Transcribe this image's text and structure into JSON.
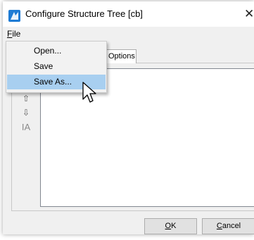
{
  "window": {
    "title": "Configure Structure Tree [cb]",
    "close_glyph": "✕",
    "icon": "app-logo-icon"
  },
  "menubar": {
    "file_label_underlined": "F",
    "file_label_rest": "ile"
  },
  "file_menu": {
    "items": [
      {
        "label": "Open..."
      },
      {
        "label": "Save"
      },
      {
        "label": "Save As...",
        "highlighted": true
      }
    ]
  },
  "tabs": {
    "options_label": "Options"
  },
  "side_toolbar": {
    "up_glyph": "⇧",
    "down_glyph": "⇩",
    "rename_glyph": "IA"
  },
  "buttons": {
    "ok_underlined": "O",
    "ok_rest": "K",
    "cancel_underlined": "C",
    "cancel_rest": "ancel"
  },
  "colors": {
    "menu_highlight": "#a8cff0",
    "logo": "#1e7bd4"
  }
}
